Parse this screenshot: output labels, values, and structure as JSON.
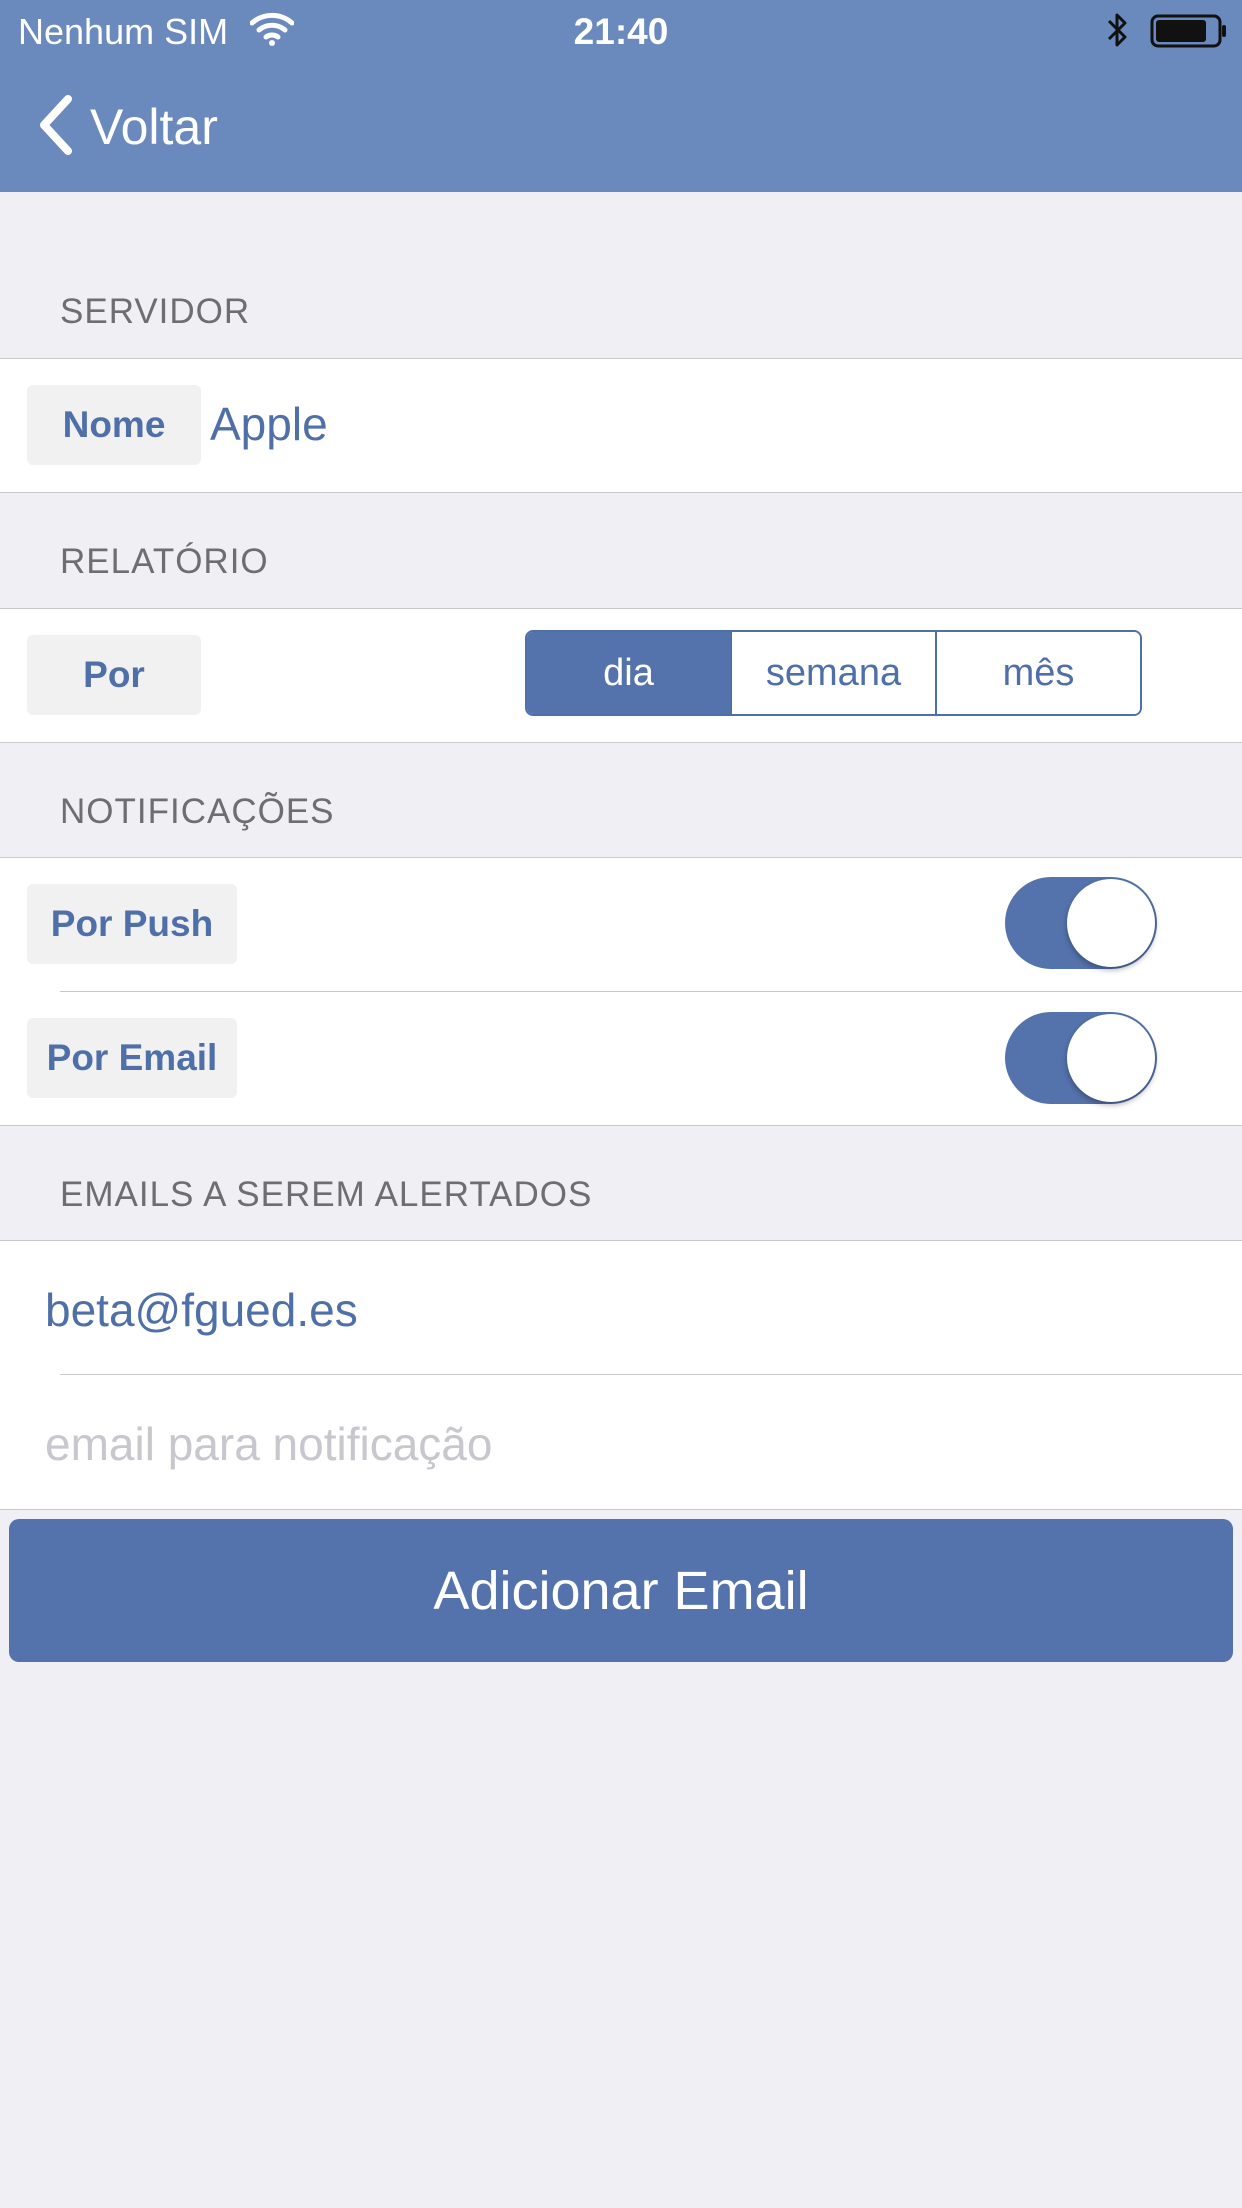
{
  "status_bar": {
    "carrier": "Nenhum SIM",
    "time": "21:40",
    "wifi_icon": "wifi-icon",
    "bluetooth_icon": "bluetooth-icon",
    "battery_icon": "battery-icon"
  },
  "nav": {
    "back_label": "Voltar",
    "back_icon": "chevron-left-icon"
  },
  "servidor": {
    "header": "SERVIDOR",
    "name_label": "Nome",
    "name_value": "Apple"
  },
  "relatorio": {
    "header": "RELATÓRIO",
    "by_label": "Por",
    "segments": [
      "dia",
      "semana",
      "mês"
    ],
    "selected_segment": "dia"
  },
  "notificacoes": {
    "header": "NOTIFICAÇÕES",
    "push_label": "Por Push",
    "push_enabled": true,
    "email_label": "Por Email",
    "email_enabled": true
  },
  "emails": {
    "header": "EMAILS A SEREM ALERTADOS",
    "list": [
      "beta@fgued.es"
    ],
    "input_placeholder": "email para notificação",
    "input_value": ""
  },
  "add_button_label": "Adicionar Email",
  "colors": {
    "navbar": "#6a89bc",
    "accent": "#5472ac",
    "background": "#efeff4"
  }
}
